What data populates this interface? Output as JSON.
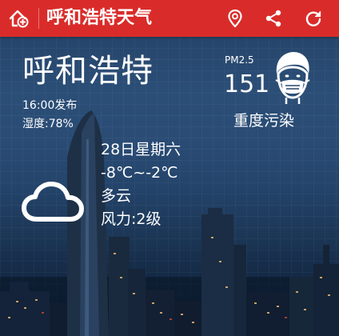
{
  "appbar": {
    "title": "呼和浩特天气",
    "color": "#d92c2a",
    "icons": [
      "home-add-icon",
      "location-pin-icon",
      "share-icon",
      "refresh-icon"
    ]
  },
  "weather": {
    "city": "呼和浩特",
    "publish_time": "16:00发布",
    "humidity": "湿度:78%"
  },
  "air_quality": {
    "label": "PM2.5",
    "value": "151",
    "level": "重度污染",
    "icon": "face-mask-icon"
  },
  "forecast": {
    "date": "28日星期六",
    "temperature": "-8℃~-2℃",
    "condition": "多云",
    "wind": "风力:2级",
    "icon": "cloud-icon"
  }
}
